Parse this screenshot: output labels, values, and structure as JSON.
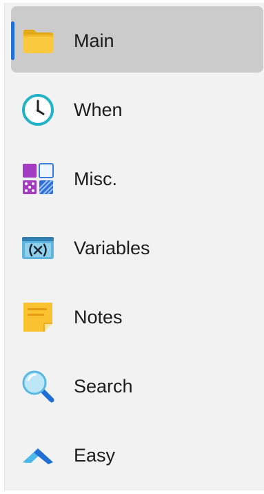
{
  "nav": {
    "items": [
      {
        "label": "Main",
        "icon": "folder-icon",
        "selected": true
      },
      {
        "label": "When",
        "icon": "clock-icon",
        "selected": false
      },
      {
        "label": "Misc.",
        "icon": "misc-tiles-icon",
        "selected": false
      },
      {
        "label": "Variables",
        "icon": "variables-icon",
        "selected": false
      },
      {
        "label": "Notes",
        "icon": "sticky-note-icon",
        "selected": false
      },
      {
        "label": "Search",
        "icon": "magnifier-icon",
        "selected": false
      },
      {
        "label": "Easy",
        "icon": "chevron-up-icon",
        "selected": false
      }
    ]
  },
  "colors": {
    "panel_background": "#f2f2f2",
    "selected_background": "#cbcbcb",
    "selection_indicator": "#1f6fd6",
    "text": "#1c1c1c"
  }
}
